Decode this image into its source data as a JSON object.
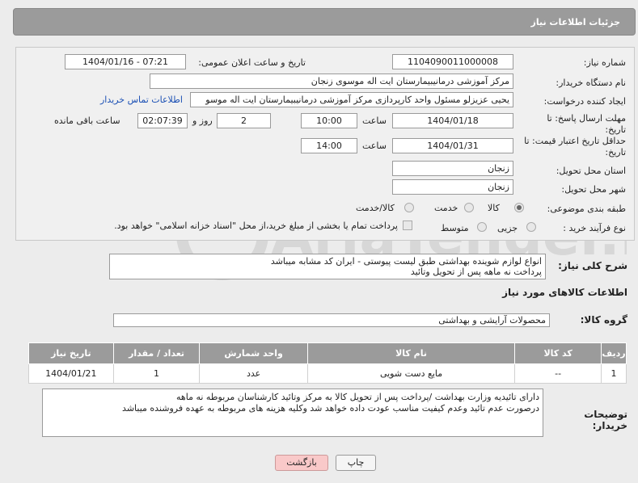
{
  "header": {
    "title": "جزئیات اطلاعات نیاز"
  },
  "fields": {
    "need_number": {
      "label": "شماره نیاز:",
      "value": "1104090011000008"
    },
    "announce": {
      "label": "تاریخ و ساعت اعلان عمومی:",
      "value": "1404/01/16 - 07:21"
    },
    "buyer_org": {
      "label": "نام دستگاه خریدار:",
      "value": "مرکز آموزشی درمانیبیمارستان ایت اله موسوی زنجان"
    },
    "creator": {
      "label": "ایجاد کننده درخواست:",
      "value": "یحیی عزیزلو مسئول واحد کارپردازی مرکز آموزشی درمانیبیمارستان ایت اله موسو",
      "link": "اطلاعات تماس خریدار"
    },
    "deadline": {
      "label": "مهلت ارسال پاسخ: تا تاریخ:",
      "date": "1404/01/18",
      "time_label": "ساعت",
      "time": "10:00",
      "days": "2",
      "days_label": "روز و",
      "remaining": "02:07:39",
      "remaining_label": "ساعت باقی مانده"
    },
    "validity": {
      "label": "حداقل تاریخ اعتبار قیمت: تا تاریخ:",
      "date": "1404/01/31",
      "time_label": "ساعت",
      "time": "14:00"
    },
    "province": {
      "label": "استان محل تحویل:",
      "value": "زنجان"
    },
    "city": {
      "label": "شهر محل تحویل:",
      "value": "زنجان"
    },
    "category": {
      "label": "طبقه بندی موضوعی:",
      "options": [
        "کالا",
        "خدمت",
        "کالا/خدمت"
      ],
      "selected": "کالا"
    },
    "process": {
      "label": "نوع فرآیند خرید :",
      "options": [
        "جزیی",
        "متوسط"
      ],
      "checkbox_text": "پرداخت تمام یا بخشی از مبلغ خرید،از محل \"اسناد خزانه اسلامی\" خواهد بود."
    }
  },
  "description": {
    "label": "شرح کلی نیاز:",
    "line1": "انواع لوازم شوینده بهداشتی طبق لیست پیوستی - ایران کد مشابه میباشد",
    "line2": "پرداخت نه ماهه پس از تحویل وتائید"
  },
  "goods_info": {
    "title": "اطلاعات کالاهای مورد نیاز",
    "group_label": "گروه کالا:",
    "group_value": "محصولات آرایشی و بهداشتی"
  },
  "table": {
    "headers": [
      "ردیف",
      "کد کالا",
      "نام کالا",
      "واحد شمارش",
      "تعداد / مقدار",
      "تاریخ نیاز"
    ],
    "rows": [
      [
        "1",
        "--",
        "مایع دست شویی",
        "عدد",
        "1",
        "1404/01/21"
      ]
    ]
  },
  "buyer_notes": {
    "label": "توضیحات خریدار:",
    "line1": "دارای تائیدیه وزارت بهداشت /پرداخت پس از تحویل کالا به مرکز وتائید کارشناسان مربوطه نه ماهه",
    "line2": "درصورت عدم تائید وعدم کیفیت مناسب عودت داده خواهد شد وکلیه هزینه های مربوطه به عهده فروشنده میباشد"
  },
  "buttons": {
    "print": "چاپ",
    "back": "بازگشت"
  },
  "watermark": "AriaTender.net"
}
